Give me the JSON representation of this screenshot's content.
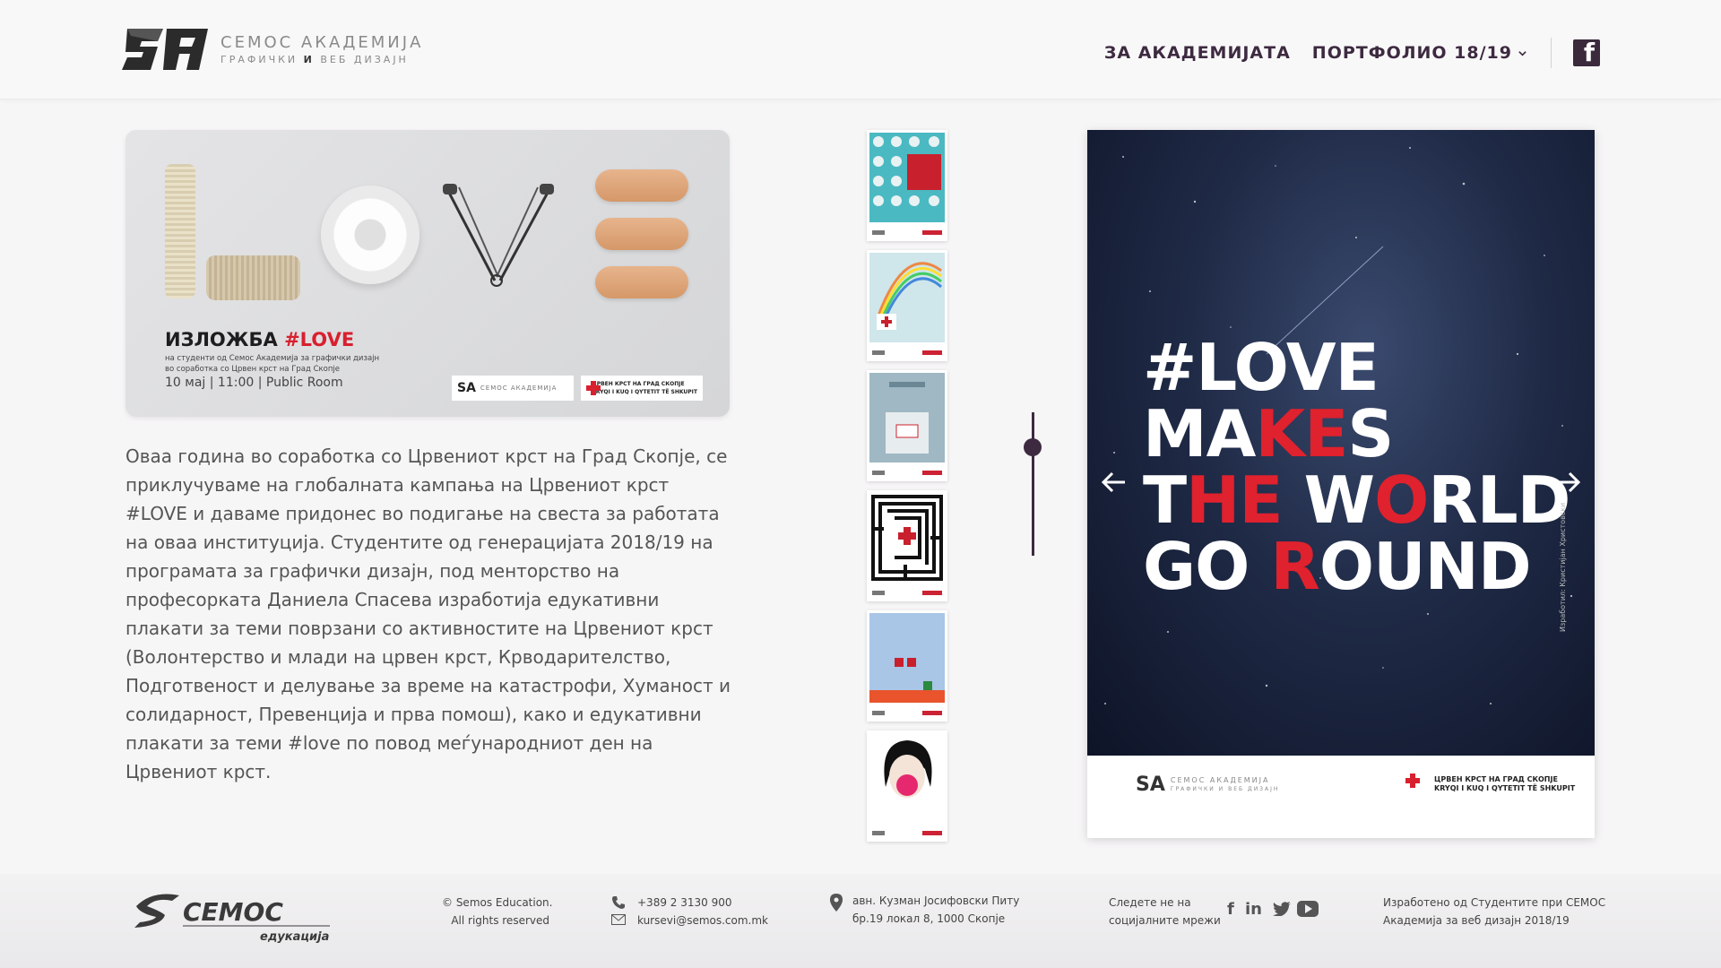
{
  "header": {
    "logo_title": "СЕМОС АКАДЕМИЈА",
    "logo_sub_1": "ГРАФИЧКИ",
    "logo_sub_and": "И",
    "logo_sub_2": "ВЕБ ДИЗАЈН",
    "nav": [
      "ЗА АКАДЕМИЈАТА",
      "ПОРТФОЛИО 18/19"
    ],
    "facebook_icon": "facebook-icon"
  },
  "event": {
    "title_prefix": "ИЗЛОЖБА",
    "title_tag": "#LOVE",
    "line1": "на студенти од Семос Академија за графички дизајн",
    "line2": "во соработка со Црвен крст на Град Скопје",
    "date": "10 мај | 11:00 | Public Room",
    "badge_semos": "СЕМОС АКАДЕМИЈА",
    "badge_rc_1": "ЦРВЕН КРСТ НА ГРАД СКОПЈЕ",
    "badge_rc_2": "KRYQI I KUQ I QYTETIT TË SHKUPIT"
  },
  "description": "Оваа година во соработка со Црвениот крст на Град Скопје, се приклучуваме на глобалната кампања на Црвениот крст #LOVE и даваме придонес во подигање на свеста за работата на оваа институција. Студентите од генерацијата 2018/19 на програмата за графички дизајн, под менторство на професорката Даниела Спасева изработија едукативни плакати за теми поврзани со активностите на Црвениот крст (Волонтерство и млади на црвен крст, Крводарителство, Подготвеност и делување за време на катастрофи, Хуманост и солидарност, Превенција и прва помош), како и едукативни плакати за теми #love по повод меѓународниот ден на Црвениот крст.",
  "thumbnails": [
    "poster-1",
    "poster-2",
    "poster-3",
    "poster-4",
    "poster-5",
    "poster-6"
  ],
  "slider": {
    "position": 0.2
  },
  "poster": {
    "lines": [
      "#LOVE",
      "MAKES",
      "THE WORLD",
      "GO ROUND"
    ],
    "credit": "Изработил: Кристијан Христовски",
    "foot_semos": "СЕМОС АКАДЕМИЈА",
    "foot_semos_sub": "ГРАФИЧКИ И ВЕБ ДИЗАЈН",
    "foot_rc_1": "ЦРВЕН КРСТ НА ГРАД СКОПЈЕ",
    "foot_rc_2": "KRYQI I KUQ I QYTETIT TË SHKUPIT"
  },
  "footer": {
    "brand": "СЕМОС",
    "brand_sub": "едукација",
    "copyright_1": "© Semos Education.",
    "copyright_2": "All rights reserved",
    "phone": "+389 2 3130 900",
    "email": "kursevi@semos.com.mk",
    "address_1": "авн. Кузман Јосифовски Питу",
    "address_2": "бр.19 локал 8,  1000 Скопје",
    "social_1": "Следете не на",
    "social_2": "социјалните мрежи",
    "made_1": "Изработено од Студентите при СЕМОС",
    "made_2": "Академија за веб дизајн 2018/19"
  },
  "colors": {
    "accent": "#3d2a40",
    "red": "#d8202e"
  }
}
